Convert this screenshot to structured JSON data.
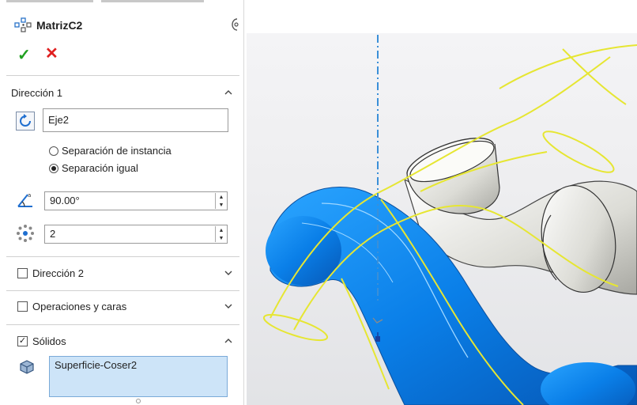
{
  "feature": {
    "title": "MatrizC2"
  },
  "direction1": {
    "label": "Dirección 1",
    "axis_value": "Eje2",
    "radio_instance": "Separación de instancia",
    "radio_equal": "Separación igual",
    "selected_radio": "Separación igual",
    "angle_value": "90.00°",
    "count_value": "2"
  },
  "direction2": {
    "label": "Dirección 2",
    "checked": false
  },
  "features_faces": {
    "label": "Operaciones y caras",
    "checked": false
  },
  "bodies": {
    "label": "Sólidos",
    "checked": true,
    "selection": "Superficie-Coser2"
  },
  "colors": {
    "accent_blue": "#1f8fe8",
    "selection_yellow": "#e6e632",
    "selection_box": "#cde4f8"
  },
  "icons": [
    "circular-pattern-icon",
    "help-icon",
    "ok-check-icon",
    "cancel-x-icon",
    "rotate-direction-icon",
    "angle-icon",
    "instances-icon",
    "body-icon",
    "chevron-up-icon",
    "chevron-down-icon",
    "triad-icon"
  ]
}
